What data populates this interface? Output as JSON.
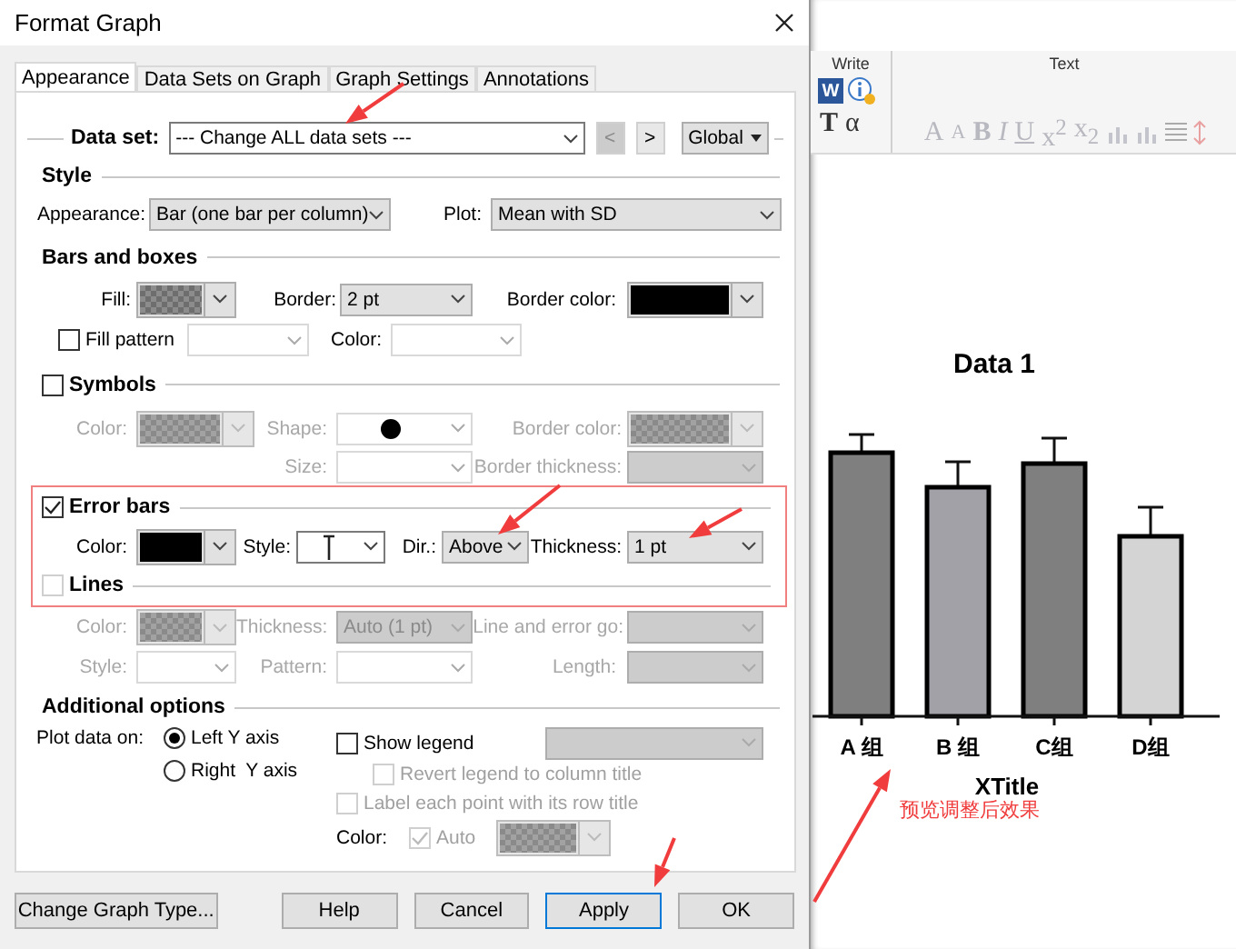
{
  "window": {
    "title": "Format Graph"
  },
  "tabs": [
    {
      "label": "Appearance",
      "selected": true
    },
    {
      "label": "Data Sets on Graph",
      "selected": false
    },
    {
      "label": "Graph Settings",
      "selected": false
    },
    {
      "label": "Annotations",
      "selected": false
    }
  ],
  "data_set": {
    "label": "Data set:",
    "value": "--- Change ALL data sets ---",
    "buttons": [
      {
        "label": "<",
        "disabled": true
      },
      {
        "label": ">",
        "disabled": false
      }
    ],
    "scope": "Global"
  },
  "style": {
    "title": "Style",
    "appearance": {
      "label": "Appearance:",
      "value": "Bar (one bar per column)"
    },
    "plot": {
      "label": "Plot:",
      "value": "Mean with SD"
    }
  },
  "bars_and_boxes": {
    "title": "Bars and boxes",
    "fill": {
      "label": "Fill:"
    },
    "border": {
      "label": "Border:",
      "value": "2 pt"
    },
    "border_color": {
      "label": "Border color:",
      "color": "#000000"
    },
    "fill_pattern": {
      "label": "Fill pattern",
      "checked": false
    },
    "color": {
      "label": "Color:"
    }
  },
  "symbols": {
    "title": "Symbols",
    "checked": false,
    "color": {
      "label": "Color:"
    },
    "shape": {
      "label": "Shape:"
    },
    "border_color": {
      "label": "Border color:"
    },
    "size": {
      "label": "Size:"
    },
    "border_thickness": {
      "label": "Border thickness:"
    }
  },
  "error_bars": {
    "title": "Error bars",
    "checked": true,
    "color": {
      "label": "Color:",
      "color": "#000000"
    },
    "style": {
      "label": "Style:"
    },
    "direction": {
      "label": "Dir.:",
      "value": "Above"
    },
    "thickness": {
      "label": "Thickness:",
      "value": "1 pt"
    }
  },
  "lines": {
    "title": "Lines",
    "checked": false,
    "color": {
      "label": "Color:"
    },
    "thickness": {
      "label": "Thickness:",
      "value": "Auto (1 pt)"
    },
    "error_gap": {
      "label": "Line and error go:"
    },
    "style": {
      "label": "Style:"
    },
    "pattern": {
      "label": "Pattern:"
    },
    "length": {
      "label": "Length:"
    }
  },
  "additional": {
    "title": "Additional options",
    "plot_on_label": "Plot data on:",
    "axes": [
      {
        "label": "Left Y axis",
        "selected": true
      },
      {
        "label": "Right  Y axis",
        "selected": false
      }
    ],
    "show_legend": {
      "label": "Show legend",
      "checked": false
    },
    "revert_legend": {
      "label": "Revert legend to column title",
      "checked": false
    },
    "label_points": {
      "label": "Label each point with its row title",
      "checked": false
    },
    "color_label": "Color:",
    "auto": {
      "label": "Auto",
      "checked": true
    }
  },
  "footer_buttons": [
    {
      "label": "Change Graph Type...",
      "focused": false
    },
    {
      "label": "Help",
      "focused": false
    },
    {
      "label": "Cancel",
      "focused": false
    },
    {
      "label": "Apply",
      "focused": true
    },
    {
      "label": "OK",
      "focused": false
    }
  ],
  "ribbon": {
    "write": {
      "title": "Write",
      "disabled": false,
      "tools": [
        {
          "kind": "word",
          "label": "W"
        },
        {
          "kind": "info"
        },
        {
          "kind": "text",
          "label": "T"
        },
        {
          "kind": "symbol",
          "label": "α"
        }
      ]
    },
    "text": {
      "title": "Text",
      "disabled": true,
      "tools": [
        {
          "kind": "grow",
          "label": "A"
        },
        {
          "kind": "shrink",
          "label": "A"
        },
        {
          "kind": "bold",
          "label": "B"
        },
        {
          "kind": "italic",
          "label": "I"
        },
        {
          "kind": "underline",
          "label": "U"
        },
        {
          "kind": "plain",
          "label": "x$^{2}$"
        },
        {
          "kind": "plain",
          "label": "x$_{2}$"
        },
        {
          "kind": "chart"
        },
        {
          "kind": "chart"
        },
        {
          "kind": "align"
        },
        {
          "kind": "spacing"
        }
      ]
    }
  },
  "graph": {
    "title": "Data 1",
    "bars": [
      {
        "label": "A 组",
        "color": "#7f7f7f"
      },
      {
        "label": "B 组",
        "color": "#a2a1a8"
      },
      {
        "label": "C组",
        "color": "#7f7f7f"
      },
      {
        "label": "D组",
        "color": "#d4d4d4"
      }
    ],
    "x_title": "XTitle",
    "note": "预览调整后效果"
  }
}
